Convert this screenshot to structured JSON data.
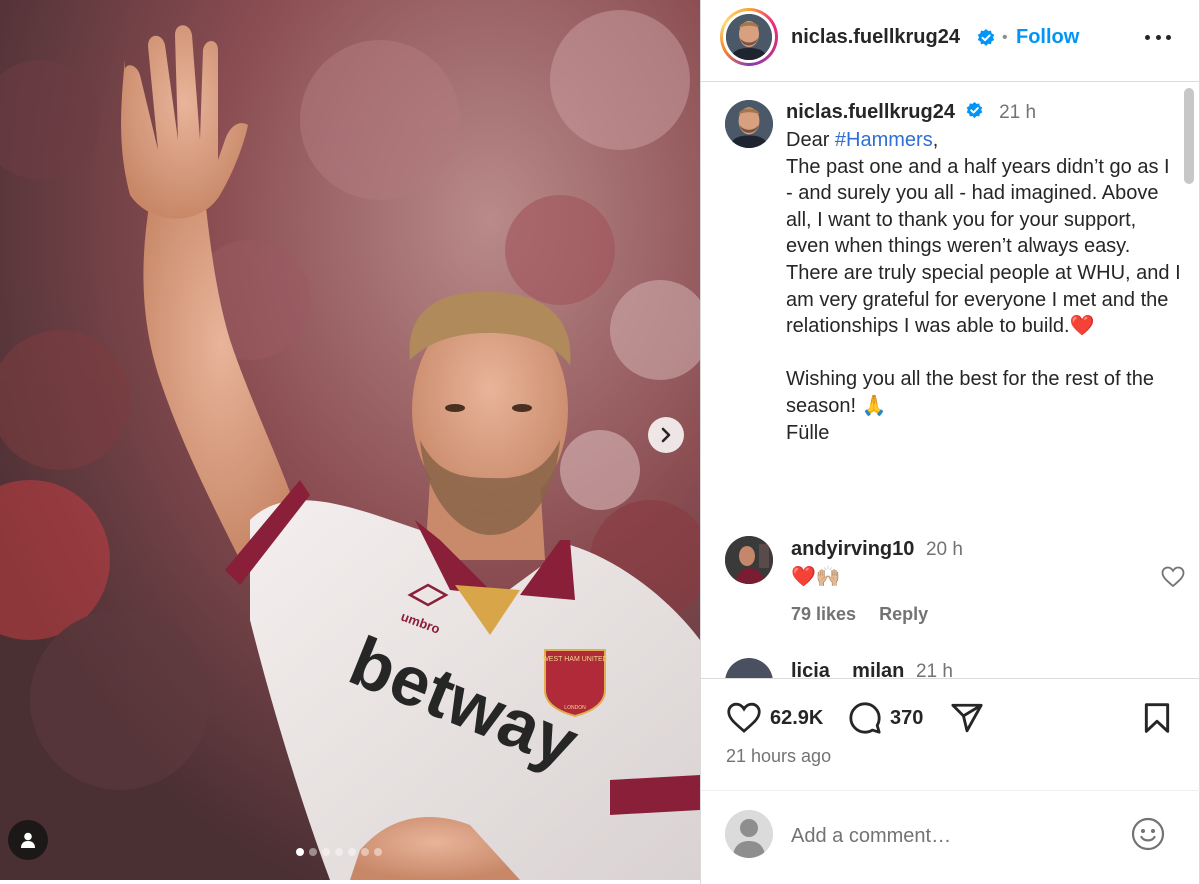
{
  "post": {
    "author": "niclas.fuellkrug24",
    "follow_label": "Follow",
    "separator": "•",
    "caption_time": "21 h",
    "caption_greeting_prefix": "Dear ",
    "caption_hashtag": "#Hammers",
    "caption_greeting_suffix": ",",
    "caption_body": "\nThe past one and a half years didn’t go as I - and surely you all - had imagined. Above all, I want to thank you for your support, even when things weren’t always easy. There are truly special people at WHU, and I am very grateful for everyone I met and the relationships I was able to build.❤️\n\nWishing you all the best for the rest of the season! 🙏\nFülle",
    "likes": "62.9K",
    "comments_count": "370",
    "posted_ago": "21 hours ago"
  },
  "media": {
    "carousel_count": 7,
    "active_index": 0,
    "shirt_sponsor": "betway",
    "shirt_brand": "umbro",
    "crest_text_top": "WEST HAM UNITED",
    "crest_text_bottom": "LONDON"
  },
  "comments": [
    {
      "user": "andyirving10",
      "time": "20 h",
      "text": "❤️🙌🏼",
      "likes": "79 likes",
      "reply_label": "Reply"
    },
    {
      "user": "licia__milan",
      "time": "21 h"
    }
  ],
  "add_comment": {
    "placeholder": "Add a comment…"
  },
  "colors": {
    "accent": "#0095f6",
    "verified": "#0095f6",
    "muted": "#737373",
    "border": "#dbdbdb"
  },
  "icons": {
    "next": "chevron-right-icon",
    "user_tag": "user-icon",
    "verified": "verified-badge-icon",
    "more": "more-horizontal-icon",
    "like": "heart-icon",
    "comment": "comment-bubble-icon",
    "share": "send-icon",
    "save": "bookmark-icon",
    "emoji": "emoji-smile-icon"
  }
}
